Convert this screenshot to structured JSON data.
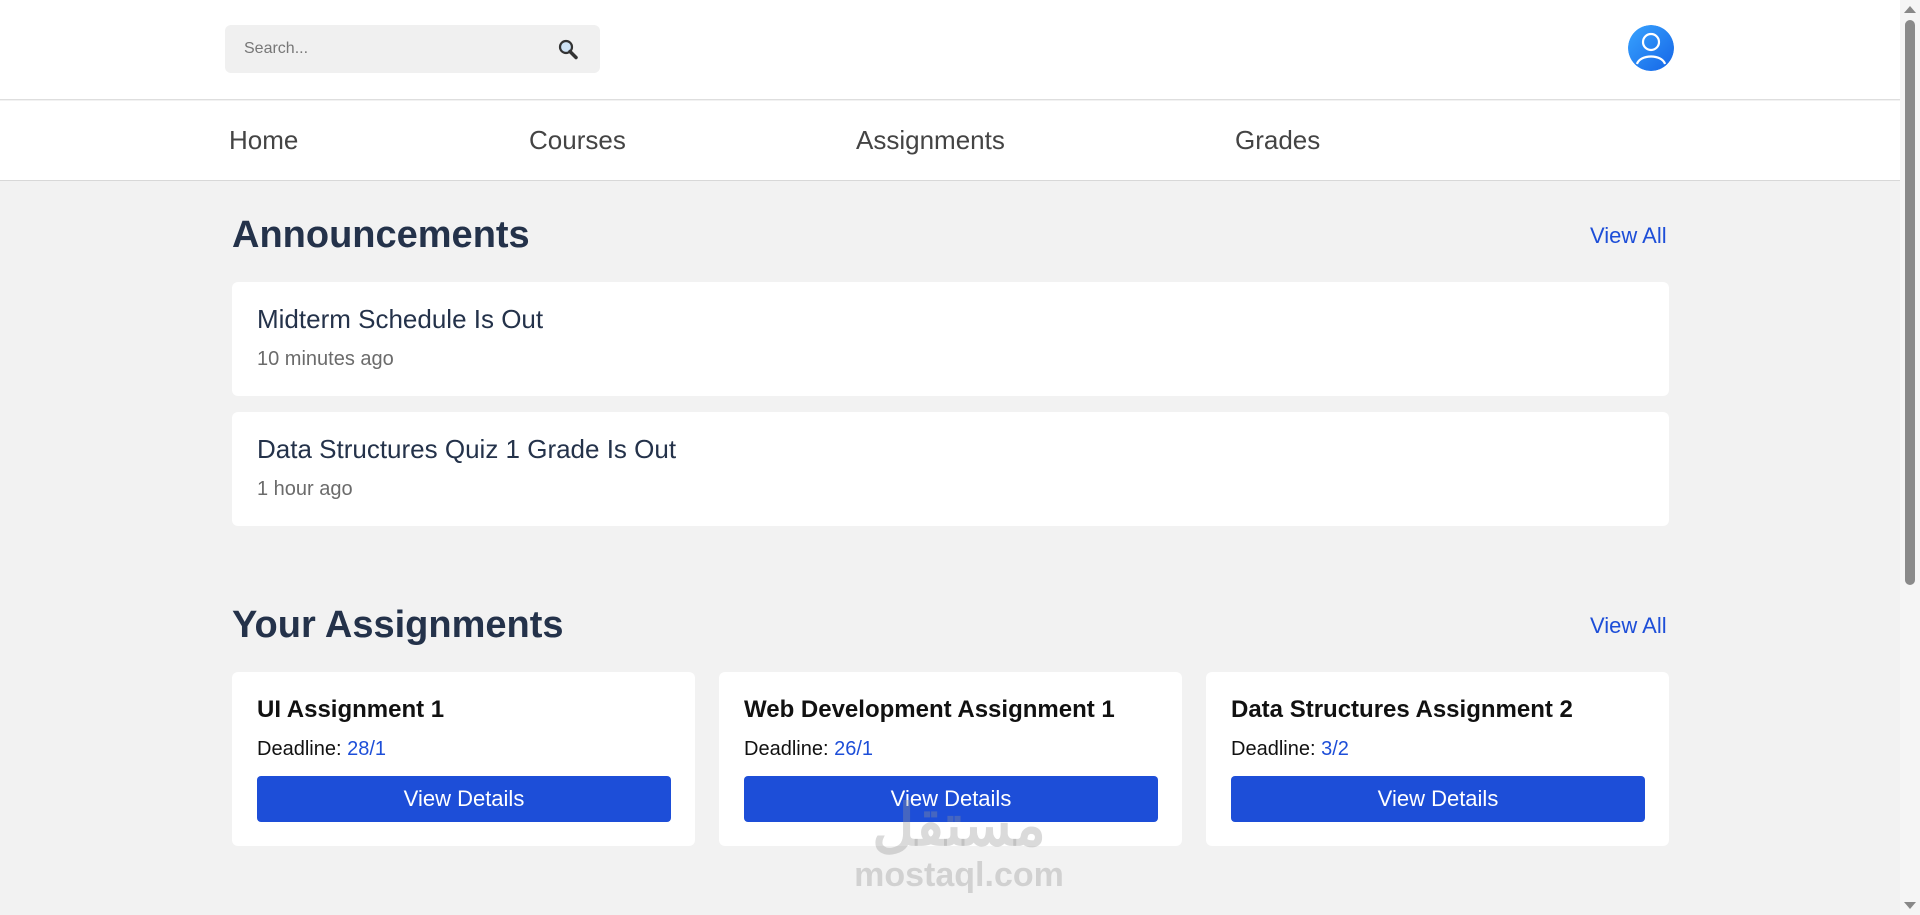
{
  "header": {
    "search": {
      "placeholder": "Search...",
      "value": ""
    }
  },
  "nav": {
    "items": [
      {
        "label": "Home"
      },
      {
        "label": "Courses"
      },
      {
        "label": "Assignments"
      },
      {
        "label": "Grades"
      }
    ]
  },
  "announcements": {
    "title": "Announcements",
    "view_all": "View All",
    "items": [
      {
        "title": "Midterm Schedule Is Out",
        "time": "10 minutes ago"
      },
      {
        "title": "Data Structures Quiz 1 Grade Is Out",
        "time": "1 hour ago"
      }
    ]
  },
  "assignments": {
    "title": "Your Assignments",
    "view_all": "View All",
    "items": [
      {
        "title": "UI Assignment 1",
        "deadline_label": "Deadline:",
        "deadline": "28/1",
        "button": "View Details"
      },
      {
        "title": "Web Development Assignment 1",
        "deadline_label": "Deadline:",
        "deadline": "26/1",
        "button": "View Details"
      },
      {
        "title": "Data Structures Assignment 2",
        "deadline_label": "Deadline:",
        "deadline": "3/2",
        "button": "View Details"
      }
    ]
  },
  "watermark": {
    "logo": "مستقل",
    "text": "mostaql.com"
  },
  "icons": {
    "search": "search-icon",
    "avatar": "user-avatar-icon"
  },
  "colors": {
    "accent": "#1d4ed8",
    "heading": "#24324a",
    "background": "#f2f2f2"
  }
}
